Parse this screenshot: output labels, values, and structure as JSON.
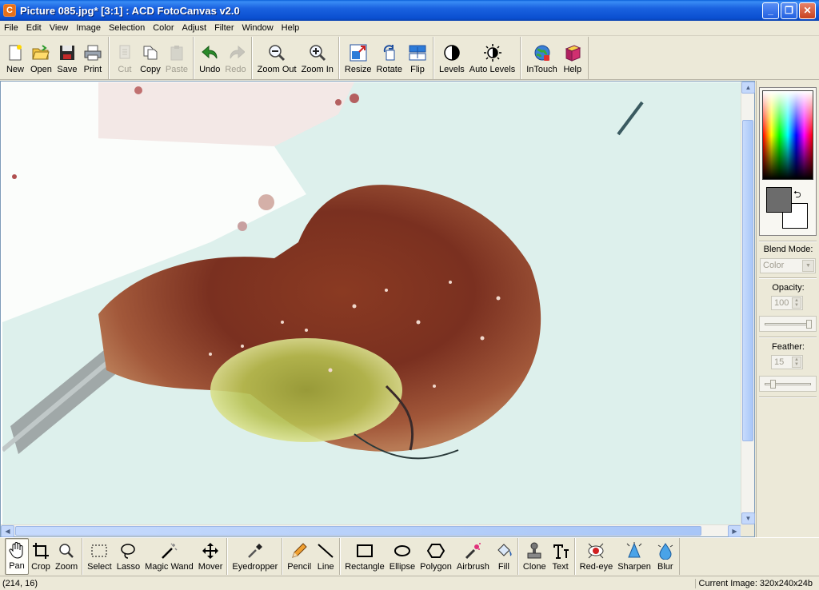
{
  "window": {
    "title": "Picture 085.jpg* [3:1] : ACD FotoCanvas v2.0",
    "app_icon_letter": "C",
    "minimize": "_",
    "maximize": "❐",
    "close": "✕"
  },
  "menu": [
    "File",
    "Edit",
    "View",
    "Image",
    "Selection",
    "Color",
    "Adjust",
    "Filter",
    "Window",
    "Help"
  ],
  "toolbar": {
    "new": "New",
    "open": "Open",
    "save": "Save",
    "print": "Print",
    "cut": "Cut",
    "copy": "Copy",
    "paste": "Paste",
    "undo": "Undo",
    "redo": "Redo",
    "zoom_out": "Zoom Out",
    "zoom_in": "Zoom In",
    "resize": "Resize",
    "rotate": "Rotate",
    "flip": "Flip",
    "levels": "Levels",
    "auto_levels": "Auto Levels",
    "intouch": "InTouch",
    "help": "Help"
  },
  "panel": {
    "blend_mode_label": "Blend Mode:",
    "blend_mode_value": "Color",
    "opacity_label": "Opacity:",
    "opacity_value": "100",
    "opacity_level": 1.0,
    "feather_label": "Feather:",
    "feather_value": "15",
    "feather_level": 0.15,
    "foreground_color": "#6c6c6c",
    "background_color": "#ffffff"
  },
  "tools": {
    "pan": "Pan",
    "crop": "Crop",
    "zoom": "Zoom",
    "select": "Select",
    "lasso": "Lasso",
    "magic_wand": "Magic Wand",
    "mover": "Mover",
    "eyedropper": "Eyedropper",
    "pencil": "Pencil",
    "line": "Line",
    "rectangle": "Rectangle",
    "ellipse": "Ellipse",
    "polygon": "Polygon",
    "airbrush": "Airbrush",
    "fill": "Fill",
    "clone": "Clone",
    "text": "Text",
    "red_eye": "Red-eye",
    "sharpen": "Sharpen",
    "blur": "Blur"
  },
  "status": {
    "coords": "(214, 16)",
    "current_image": "Current Image: 320x240x24b"
  }
}
